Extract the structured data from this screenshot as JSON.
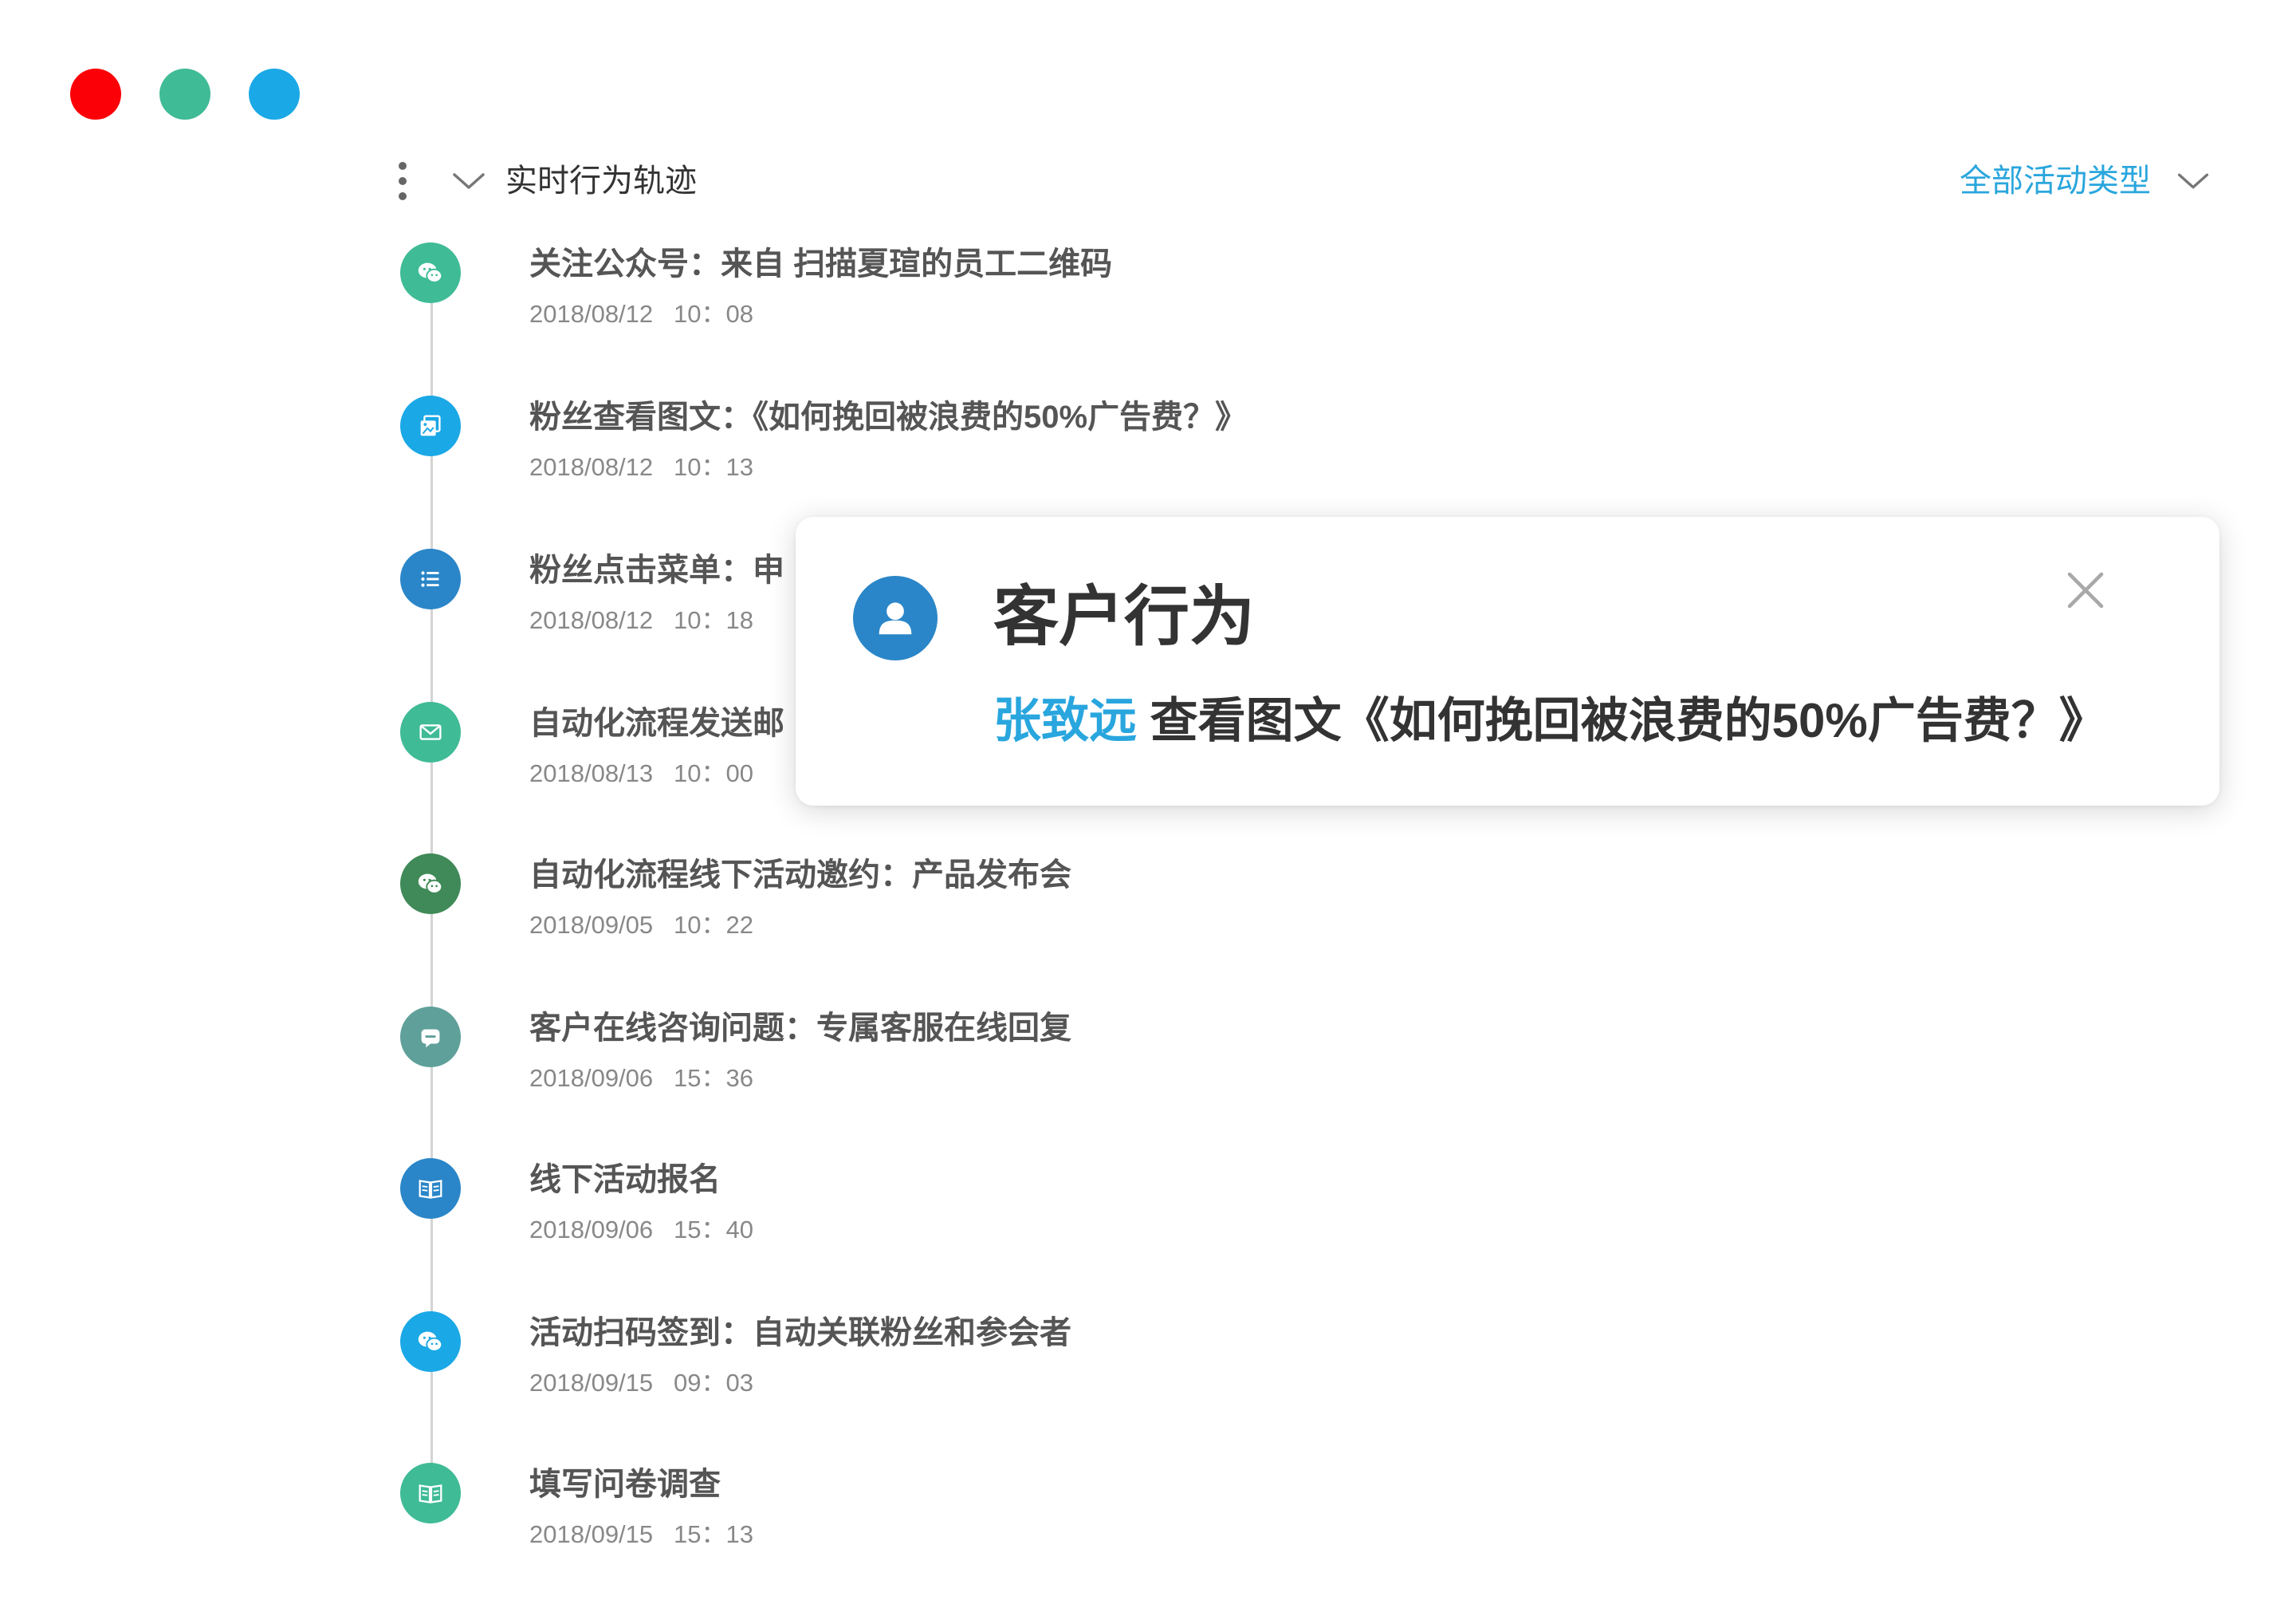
{
  "window": {
    "controls": [
      {
        "name": "close",
        "color": "#fb0007"
      },
      {
        "name": "minimize",
        "color": "#3fbb96"
      },
      {
        "name": "maximize",
        "color": "#1ba8e6"
      }
    ]
  },
  "header": {
    "more_icon": "kebab-icon",
    "collapse_icon": "chevron-down-icon",
    "title": "实时行为轨迹",
    "filter": {
      "label": "全部活动类型",
      "icon": "chevron-down-icon",
      "color": "#2aa6dd"
    }
  },
  "timeline": {
    "items": [
      {
        "icon": "wechat-icon",
        "color": "#3fbb96",
        "title": "关注公众号：来自 扫描夏瑄的员工二维码",
        "date": "2018/08/12",
        "time": "10：08"
      },
      {
        "icon": "image-article-icon",
        "color": "#1ba8e6",
        "title": "粉丝查看图文：《如何挽回被浪费的50%广告费？》",
        "date": "2018/08/12",
        "time": "10：13"
      },
      {
        "icon": "menu-list-icon",
        "color": "#2a86c8",
        "title": "粉丝点击菜单：申",
        "date": "2018/08/12",
        "time": "10：18"
      },
      {
        "icon": "mail-icon",
        "color": "#3fbb96",
        "title": "自动化流程发送邮",
        "date": "2018/08/13",
        "time": "10：00"
      },
      {
        "icon": "wechat-icon",
        "color": "#3f8a58",
        "title": "自动化流程线下活动邀约：产品发布会",
        "date": "2018/09/05",
        "time": "10：22"
      },
      {
        "icon": "chat-icon",
        "color": "#5fa09a",
        "title": "客户在线咨询问题：专属客服在线回复",
        "date": "2018/09/06",
        "time": "15：36"
      },
      {
        "icon": "book-icon",
        "color": "#2a86c8",
        "title": "线下活动报名",
        "date": "2018/09/06",
        "time": "15：40"
      },
      {
        "icon": "wechat-icon",
        "color": "#1ba8e6",
        "title": "活动扫码签到：自动关联粉丝和参会者",
        "date": "2018/09/15",
        "time": "09：03"
      },
      {
        "icon": "book-icon",
        "color": "#3fbb96",
        "title": "填写问卷调查",
        "date": "2018/09/15",
        "time": "15：13"
      }
    ]
  },
  "popup": {
    "avatar_icon": "user-icon",
    "avatar_color": "#2a86c8",
    "title": "客户行为",
    "close_icon": "close-icon",
    "customer_name": "张致远",
    "customer_name_color": "#29a6de",
    "action": "查看图文《如何挽回被浪费的50%广告费？》"
  }
}
